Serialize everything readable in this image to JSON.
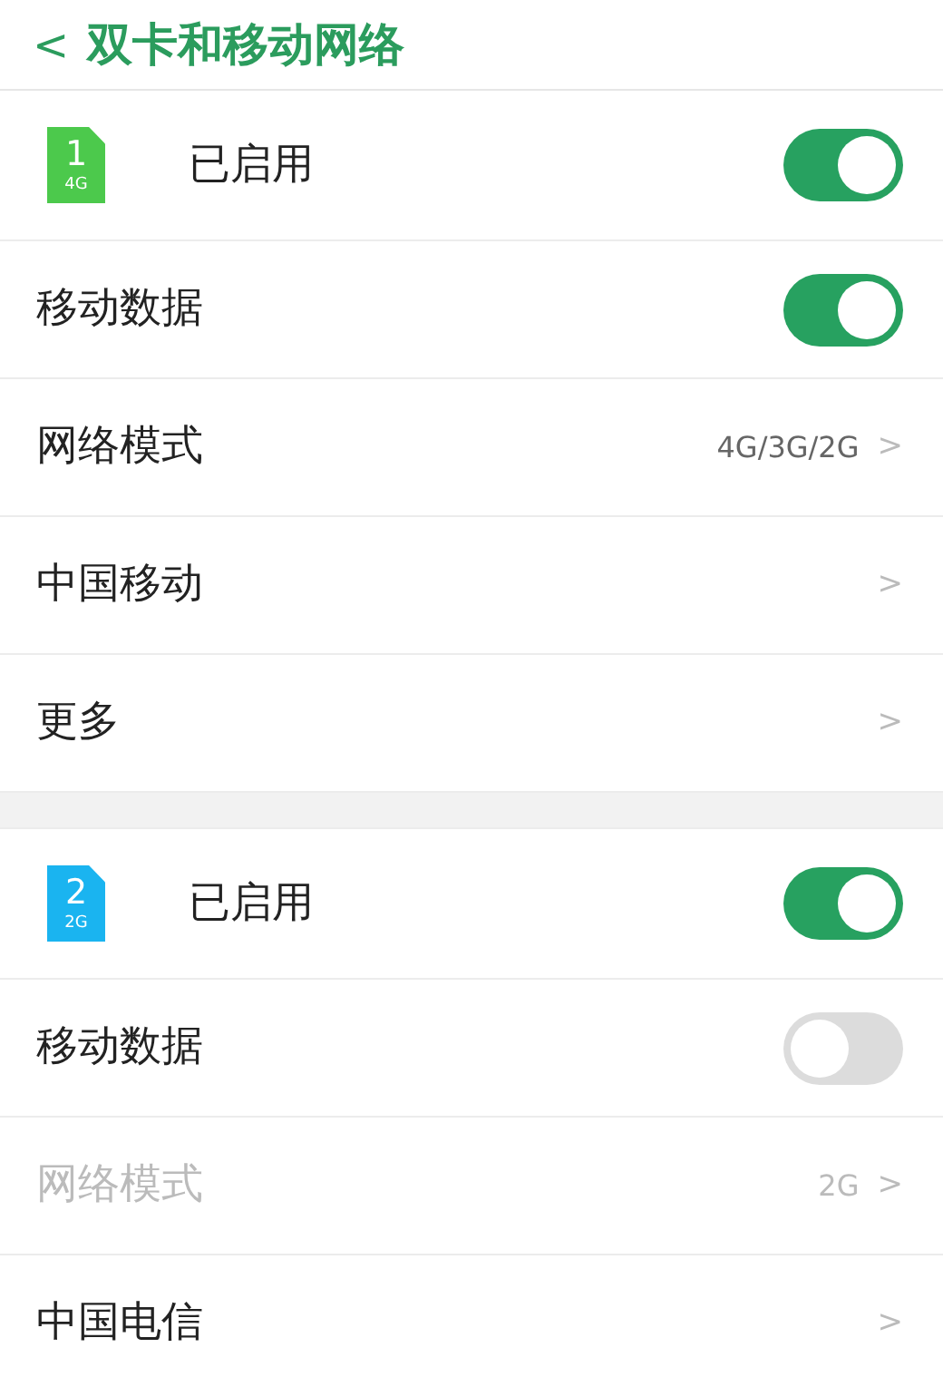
{
  "header": {
    "back": "<",
    "title": "双卡和移动网络"
  },
  "sections": [
    {
      "rows": [
        {
          "kind": "sim",
          "number": "1",
          "network": "4G",
          "color": "#4cc94c",
          "label": "已启用",
          "on": true
        },
        {
          "kind": "toggle",
          "label": "移动数据",
          "on": true
        },
        {
          "kind": "link",
          "label": "网络模式",
          "value": "4G/3G/2G",
          "chevron": ">",
          "disabled": false
        },
        {
          "kind": "link",
          "label": "中国移动",
          "chevron": ">",
          "disabled": false
        },
        {
          "kind": "link",
          "label": "更多",
          "chevron": ">",
          "disabled": false
        }
      ]
    },
    {
      "rows": [
        {
          "kind": "sim",
          "number": "2",
          "network": "2G",
          "color": "#1ab4f0",
          "label": "已启用",
          "on": true
        },
        {
          "kind": "toggle",
          "label": "移动数据",
          "on": false
        },
        {
          "kind": "link",
          "label": "网络模式",
          "value": "2G",
          "chevron": ">",
          "disabled": true
        },
        {
          "kind": "link",
          "label": "中国电信",
          "chevron": ">",
          "disabled": false
        }
      ]
    }
  ]
}
